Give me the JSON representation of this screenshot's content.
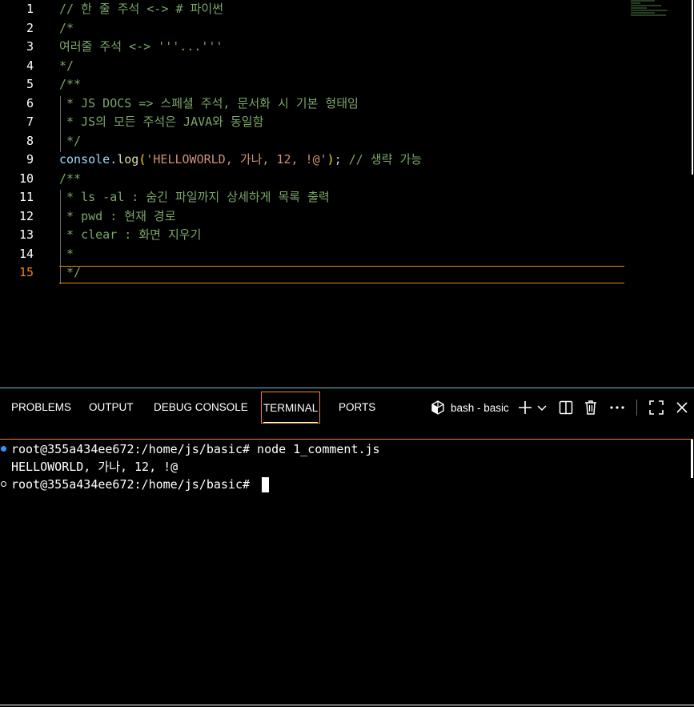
{
  "editor": {
    "lines": [
      {
        "num": "1",
        "segments": [
          {
            "t": "// 한 줄 주석 <-> # 파이썬",
            "c": "c-comment"
          }
        ]
      },
      {
        "num": "2",
        "segments": [
          {
            "t": "/*",
            "c": "c-comment"
          }
        ]
      },
      {
        "num": "3",
        "segments": [
          {
            "t": "여러줄 주석 <-> '''...'''",
            "c": "c-comment"
          }
        ]
      },
      {
        "num": "4",
        "segments": [
          {
            "t": "*/",
            "c": "c-comment"
          }
        ]
      },
      {
        "num": "5",
        "segments": [
          {
            "t": "/**",
            "c": "c-comment"
          }
        ]
      },
      {
        "num": "6",
        "segments": [
          {
            "t": " * JS DOCS => 스페셜 주석, 문서화 시 기본 형태임",
            "c": "c-comment"
          }
        ]
      },
      {
        "num": "7",
        "segments": [
          {
            "t": " * JS의 모든 주석은 JAVA와 동일함",
            "c": "c-comment"
          }
        ]
      },
      {
        "num": "8",
        "segments": [
          {
            "t": " */",
            "c": "c-comment"
          }
        ]
      },
      {
        "num": "9",
        "segments": [
          {
            "t": "console",
            "c": "c-ident"
          },
          {
            "t": ".",
            "c": "c-punct"
          },
          {
            "t": "log",
            "c": "c-fn"
          },
          {
            "t": "(",
            "c": "c-paren"
          },
          {
            "t": "'HELLOWORLD, 가나, 12, !@'",
            "c": "c-str"
          },
          {
            "t": ")",
            "c": "c-paren"
          },
          {
            "t": "; ",
            "c": "c-punct"
          },
          {
            "t": "// 생략 가능",
            "c": "c-comment"
          }
        ]
      },
      {
        "num": "10",
        "segments": [
          {
            "t": "/**",
            "c": "c-comment"
          }
        ]
      },
      {
        "num": "11",
        "segments": [
          {
            "t": " * ls -al : 숨긴 파일까지 상세하게 목록 출력",
            "c": "c-comment"
          }
        ]
      },
      {
        "num": "12",
        "segments": [
          {
            "t": " * pwd : 현재 경로",
            "c": "c-comment"
          }
        ]
      },
      {
        "num": "13",
        "segments": [
          {
            "t": " * clear : 화면 지우기",
            "c": "c-comment"
          }
        ]
      },
      {
        "num": "14",
        "segments": [
          {
            "t": " *",
            "c": "c-comment"
          }
        ]
      },
      {
        "num": "15",
        "segments": [
          {
            "t": " */",
            "c": "c-comment"
          }
        ],
        "active": true
      }
    ]
  },
  "panel": {
    "tabs": [
      {
        "label": "PROBLEMS",
        "name": "tab-problems"
      },
      {
        "label": "OUTPUT",
        "name": "tab-output"
      },
      {
        "label": "DEBUG CONSOLE",
        "name": "tab-debug-console"
      },
      {
        "label": "TERMINAL",
        "name": "tab-terminal",
        "active": true
      },
      {
        "label": "PORTS",
        "name": "tab-ports"
      }
    ],
    "terminal_name": "bash - basic",
    "icons": {
      "terminal": "terminal-icon",
      "add": "plus-icon",
      "dropdown": "chevron-down-icon",
      "split": "split-icon",
      "kill": "trash-icon",
      "more": "more-icon",
      "maximize": "maximize-icon",
      "close": "close-icon"
    }
  },
  "terminal": {
    "lines": [
      {
        "text": "root@355a434ee672:/home/js/basic# node 1_comment.js",
        "decoration": "ok"
      },
      {
        "text": "HELLOWORLD, 가나, 12, !@",
        "decoration": "none"
      },
      {
        "text": "root@355a434ee672:/home/js/basic# ",
        "decoration": "empty",
        "cursor": true
      }
    ]
  },
  "colors": {
    "comment": "#7ca668",
    "accent_border": "#f38518",
    "active_line_number": "#f38518",
    "background": "#000000",
    "panel_top_border": "#6fc3df"
  }
}
